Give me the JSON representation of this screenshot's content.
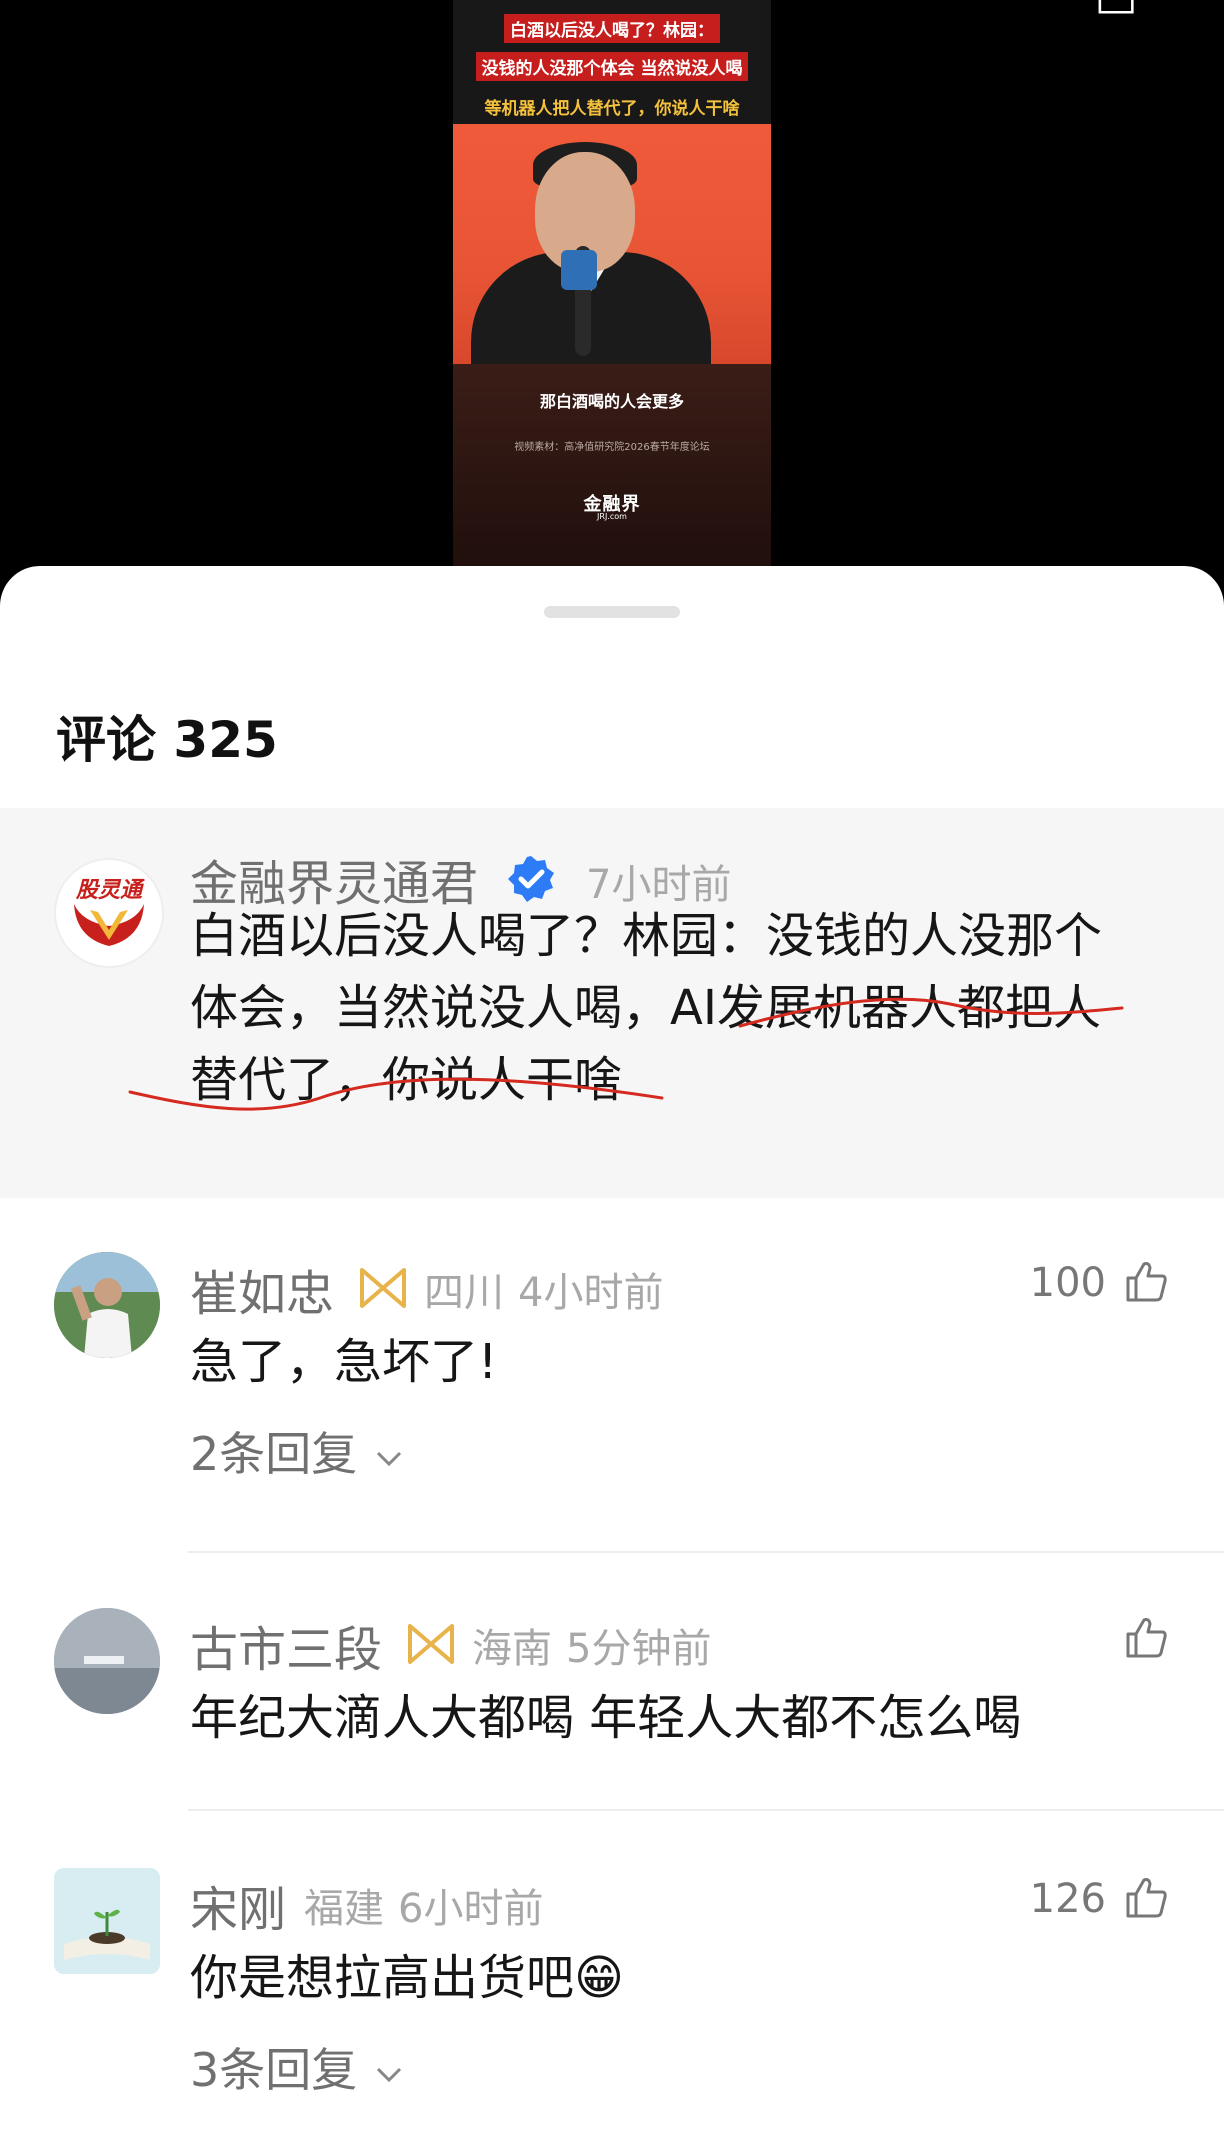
{
  "video": {
    "banner_line1": "白酒以后没人喝了？林园：",
    "banner_line2": "没钱的人没那个体会 当然说没人喝",
    "banner_line3": "等机器人把人替代了，你说人干啥",
    "caption": "那白酒喝的人会更多",
    "source": "视频素材：高净值研究院2026春节年度论坛",
    "logo": "金融界",
    "logo_sub": "JRJ.com"
  },
  "comments_header": {
    "title": "评论 325"
  },
  "pinned_comment": {
    "author": "金融界灵通君",
    "avatar_text": "股灵通",
    "time": "7小时前",
    "line1": "白酒以后没人喝了？林园：没钱的人没那个",
    "line2": "体会，当然说没人喝，AI发展机器人都把人",
    "line3": "替代了，你说人干啥"
  },
  "comments": [
    {
      "author": "崔如忠",
      "location": "四川",
      "time": "4小时前",
      "text": "急了，急坏了!",
      "likes": "100",
      "replies": "2条回复"
    },
    {
      "author": "古市三段",
      "location": "海南",
      "time": "5分钟前",
      "text": "年纪大滴人大都喝  年轻人大都不怎么喝",
      "likes": ""
    },
    {
      "author": "宋刚",
      "location": "福建",
      "time": "6小时前",
      "text": "你是想拉高出货吧",
      "emoji": "😁",
      "likes": "126",
      "replies": "3条回复"
    }
  ],
  "colors": {
    "annotation_red": "#d42a1f",
    "verified_blue": "#2d7cf6",
    "badge_gold": "#e8b34a"
  }
}
